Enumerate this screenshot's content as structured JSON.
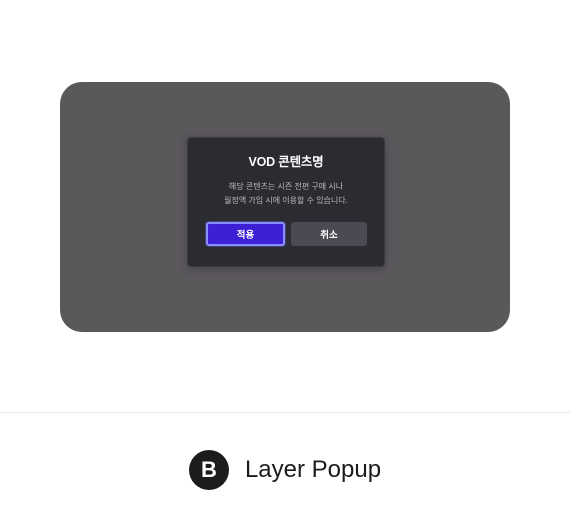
{
  "popup": {
    "title": "VOD 콘텐츠명",
    "message_line1": "해당 콘텐츠는 시즌 전편 구매 시나",
    "message_line2": "월정액 가입 시에 이용할 수 있습니다.",
    "apply_label": "적용",
    "cancel_label": "취소"
  },
  "caption": {
    "badge": "B",
    "label": "Layer Popup"
  },
  "colors": {
    "panel_bg": "#5b585c",
    "dialog_bg": "#2b2c31",
    "apply_button": "#3d1fd6",
    "apply_focus_ring": "#8a8eff",
    "cancel_button": "#4a4b52",
    "caption_badge": "#1c1c1e"
  }
}
